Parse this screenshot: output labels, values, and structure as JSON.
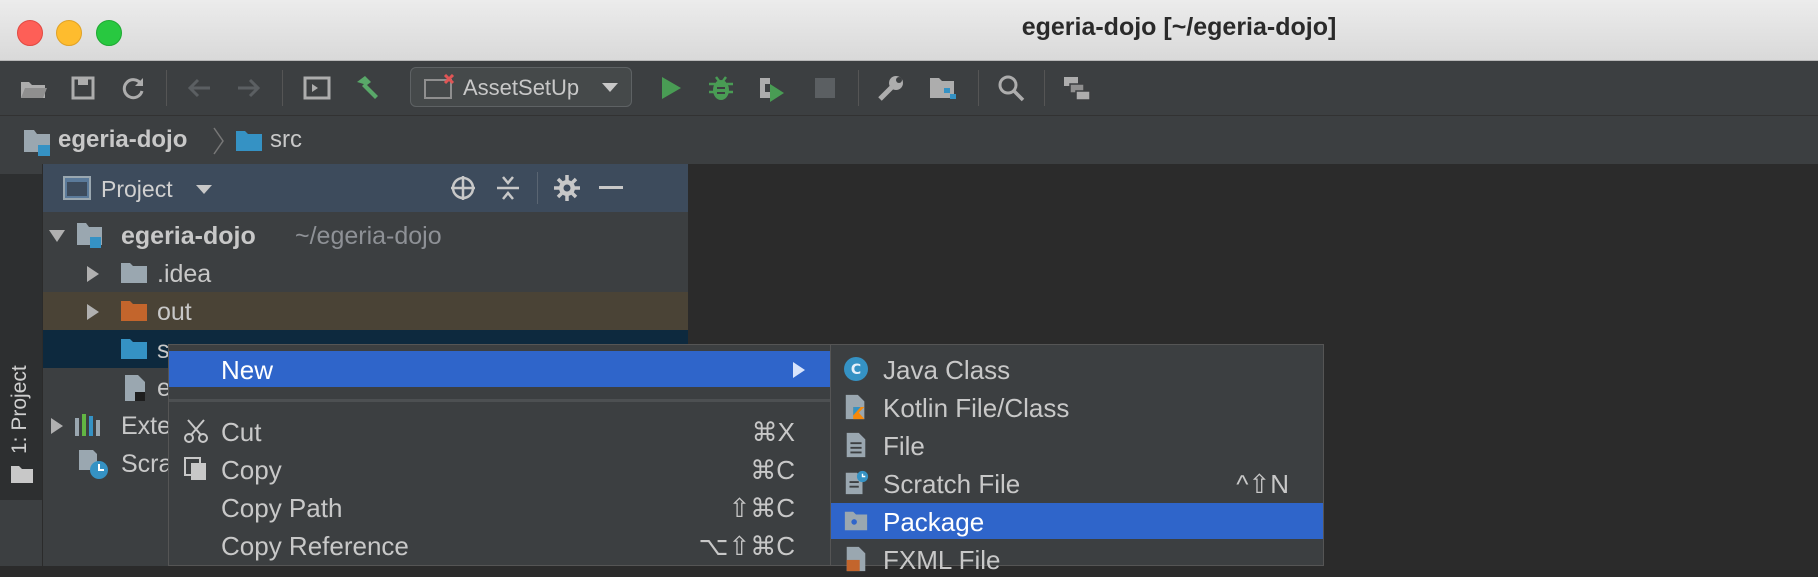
{
  "window": {
    "title": "egeria-dojo [~/egeria-dojo]"
  },
  "toolbar": {
    "run_config": "AssetSetUp",
    "icons": [
      "open-folder-icon",
      "save-icon",
      "sync-icon",
      "back-icon",
      "forward-icon",
      "run-window-icon",
      "build-hammer-icon",
      "run-icon",
      "debug-icon",
      "coverage-icon",
      "stop-icon",
      "settings-wrench-icon",
      "project-structure-icon",
      "search-icon",
      "vcs-icon"
    ]
  },
  "breadcrumb": {
    "project": "egeria-dojo",
    "folder": "src"
  },
  "sidebar": {
    "tab_label": "1: Project"
  },
  "project_panel": {
    "title": "Project",
    "root_name": "egeria-dojo",
    "root_path": "~/egeria-dojo",
    "items": [
      {
        "label": ".idea"
      },
      {
        "label": "out"
      },
      {
        "label": "src"
      },
      {
        "label": "e"
      },
      {
        "label": "Exte"
      },
      {
        "label": "Scra"
      }
    ]
  },
  "context_menu": {
    "items": [
      {
        "label": "New",
        "shortcut": ""
      },
      {
        "label": "Cut",
        "shortcut": "⌘X"
      },
      {
        "label": "Copy",
        "shortcut": "⌘C"
      },
      {
        "label": "Copy Path",
        "shortcut": "⇧⌘C"
      },
      {
        "label": "Copy Reference",
        "shortcut": "⌥⇧⌘C"
      }
    ]
  },
  "new_submenu": {
    "items": [
      {
        "label": "Java Class",
        "shortcut": ""
      },
      {
        "label": "Kotlin File/Class",
        "shortcut": ""
      },
      {
        "label": "File",
        "shortcut": ""
      },
      {
        "label": "Scratch File",
        "shortcut": "^⇧N"
      },
      {
        "label": "Package",
        "shortcut": ""
      },
      {
        "label": "FXML File",
        "shortcut": ""
      }
    ]
  },
  "colors": {
    "selection": "#2f65ca",
    "panel_header": "#3d4b5c",
    "out_row": "#4a4336",
    "src_row": "#0d293e"
  }
}
